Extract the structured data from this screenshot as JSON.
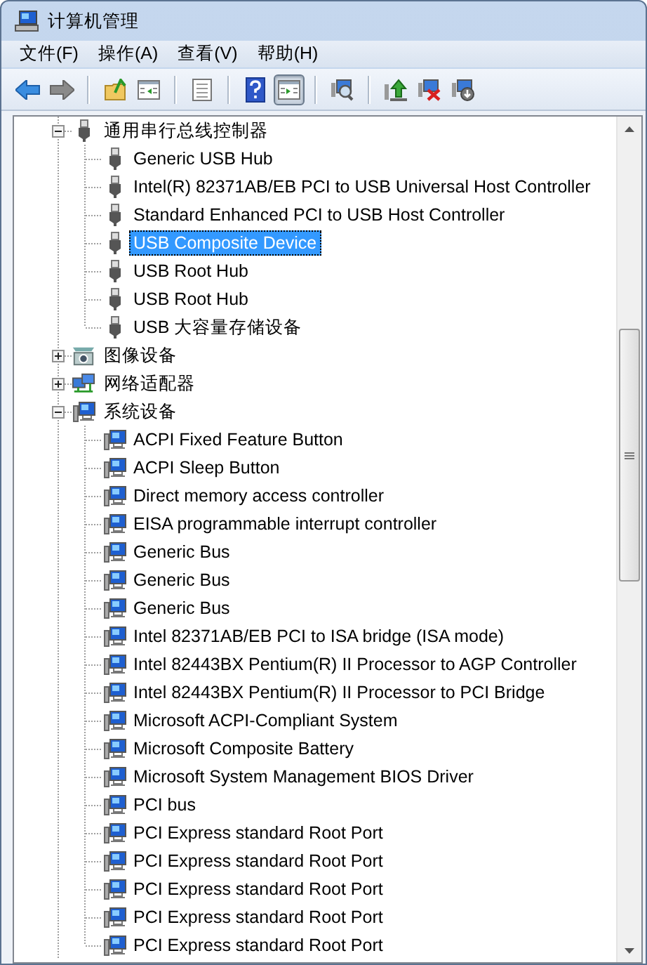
{
  "window": {
    "title": "计算机管理"
  },
  "menu": [
    "文件(F)",
    "操作(A)",
    "查看(V)",
    "帮助(H)"
  ],
  "toolbar": [
    {
      "kind": "back",
      "pressed": false
    },
    {
      "kind": "forward",
      "pressed": false
    },
    {
      "kind": "separator"
    },
    {
      "kind": "up",
      "pressed": false
    },
    {
      "kind": "tree",
      "pressed": false
    },
    {
      "kind": "separator"
    },
    {
      "kind": "properties",
      "pressed": false
    },
    {
      "kind": "separator"
    },
    {
      "kind": "help",
      "pressed": false
    },
    {
      "kind": "pane",
      "pressed": true
    },
    {
      "kind": "separator"
    },
    {
      "kind": "scan",
      "pressed": false
    },
    {
      "kind": "separator"
    },
    {
      "kind": "update",
      "pressed": false
    },
    {
      "kind": "disable",
      "pressed": false
    },
    {
      "kind": "uninstall",
      "pressed": false
    }
  ],
  "tree": [
    {
      "label": "通用串行总线控制器",
      "kind": "usb",
      "expanded": true,
      "selected": false,
      "children": [
        {
          "label": "Generic USB Hub",
          "kind": "usb",
          "selected": false
        },
        {
          "label": "Intel(R) 82371AB/EB PCI to USB Universal Host Controller",
          "kind": "usb",
          "selected": false
        },
        {
          "label": "Standard Enhanced PCI to USB Host Controller",
          "kind": "usb",
          "selected": false
        },
        {
          "label": "USB Composite Device",
          "kind": "usb",
          "selected": true
        },
        {
          "label": "USB Root Hub",
          "kind": "usb",
          "selected": false
        },
        {
          "label": "USB Root Hub",
          "kind": "usb",
          "selected": false
        },
        {
          "label": "USB 大容量存储设备",
          "kind": "usb",
          "selected": false
        }
      ]
    },
    {
      "label": "图像设备",
      "kind": "imaging",
      "expanded": false,
      "selected": false
    },
    {
      "label": "网络适配器",
      "kind": "network",
      "expanded": false,
      "selected": false
    },
    {
      "label": "系统设备",
      "kind": "system",
      "expanded": true,
      "selected": false,
      "children": [
        {
          "label": "ACPI Fixed Feature Button",
          "kind": "system",
          "selected": false
        },
        {
          "label": "ACPI Sleep Button",
          "kind": "system",
          "selected": false
        },
        {
          "label": "Direct memory access controller",
          "kind": "system",
          "selected": false
        },
        {
          "label": "EISA programmable interrupt controller",
          "kind": "system",
          "selected": false
        },
        {
          "label": "Generic Bus",
          "kind": "system",
          "selected": false
        },
        {
          "label": "Generic Bus",
          "kind": "system",
          "selected": false
        },
        {
          "label": "Generic Bus",
          "kind": "system",
          "selected": false
        },
        {
          "label": "Intel 82371AB/EB PCI to ISA bridge (ISA mode)",
          "kind": "system",
          "selected": false
        },
        {
          "label": "Intel 82443BX Pentium(R) II Processor to AGP Controller",
          "kind": "system",
          "selected": false
        },
        {
          "label": "Intel 82443BX Pentium(R) II Processor to PCI Bridge",
          "kind": "system",
          "selected": false
        },
        {
          "label": "Microsoft ACPI-Compliant System",
          "kind": "system",
          "selected": false
        },
        {
          "label": "Microsoft Composite Battery",
          "kind": "system",
          "selected": false
        },
        {
          "label": "Microsoft System Management BIOS Driver",
          "kind": "system",
          "selected": false
        },
        {
          "label": "PCI bus",
          "kind": "system",
          "selected": false
        },
        {
          "label": "PCI Express standard Root Port",
          "kind": "system",
          "selected": false
        },
        {
          "label": "PCI Express standard Root Port",
          "kind": "system",
          "selected": false
        },
        {
          "label": "PCI Express standard Root Port",
          "kind": "system",
          "selected": false
        },
        {
          "label": "PCI Express standard Root Port",
          "kind": "system",
          "selected": false
        },
        {
          "label": "PCI Express standard Root Port",
          "kind": "system",
          "selected": false
        }
      ]
    }
  ]
}
